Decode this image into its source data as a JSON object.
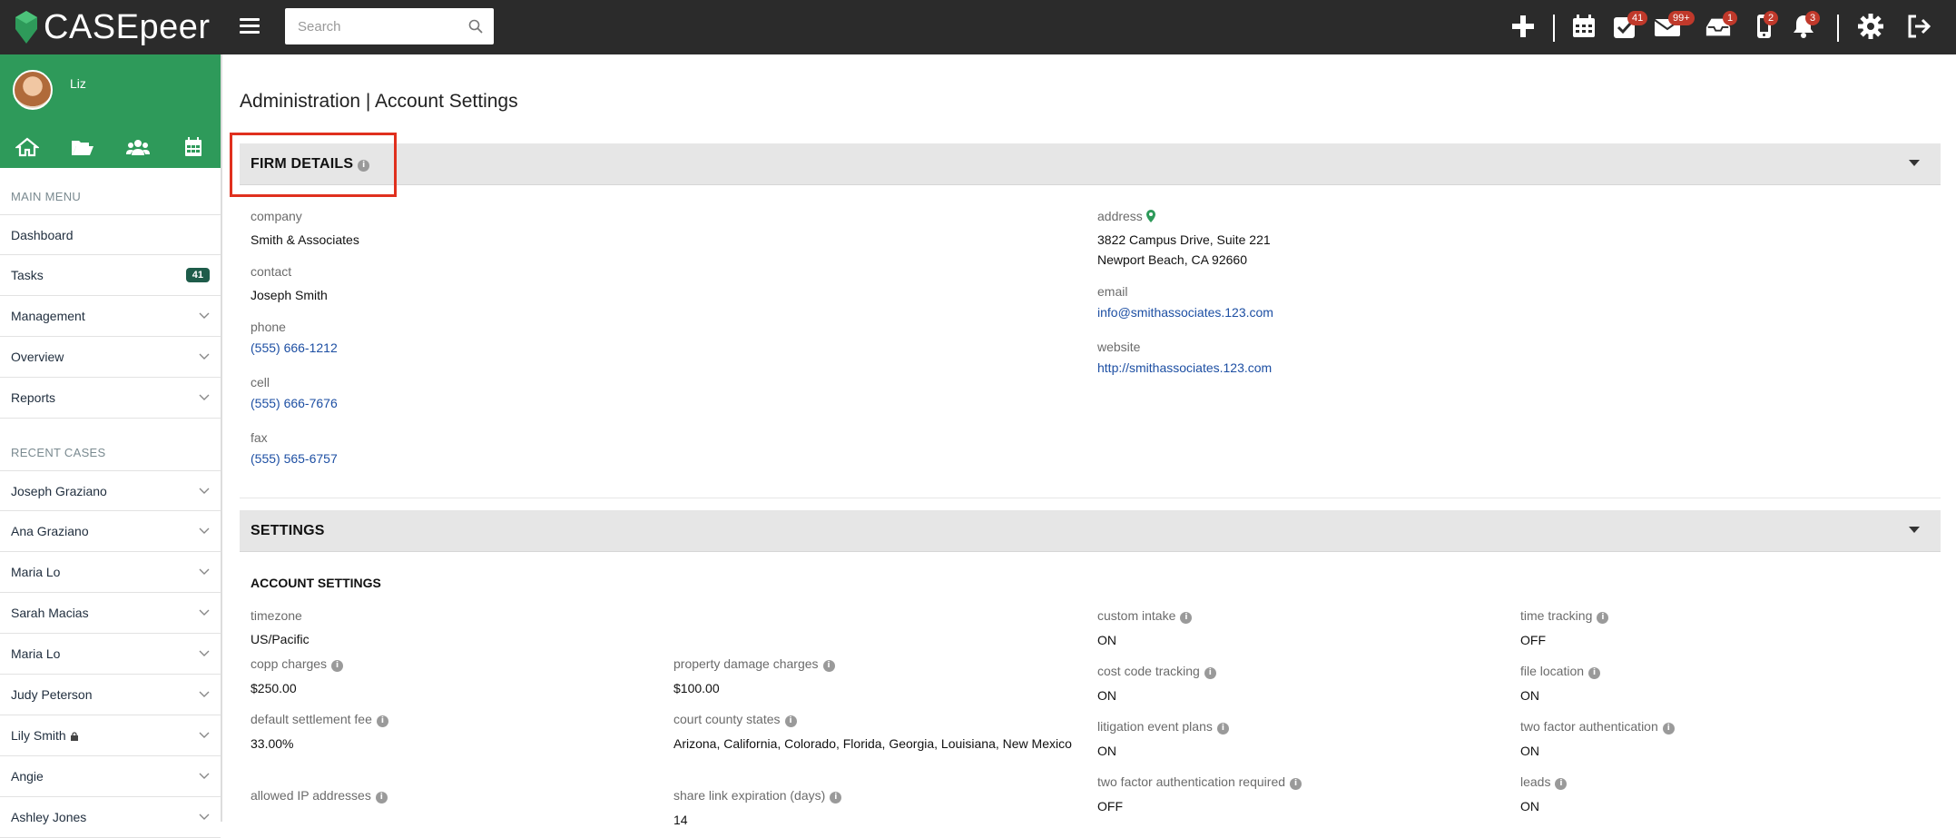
{
  "app": {
    "logo_text": "CASEpeer"
  },
  "topbar": {
    "search_placeholder": "Search",
    "badges": {
      "tasks": "41",
      "mail": "99+",
      "inbox": "1",
      "phone": "2",
      "notifications": "3"
    }
  },
  "sidebar": {
    "user_name": "Liz",
    "main_menu_title": "MAIN MENU",
    "main_menu": [
      {
        "label": "Dashboard"
      },
      {
        "label": "Tasks",
        "count": "41"
      },
      {
        "label": "Management"
      },
      {
        "label": "Overview"
      },
      {
        "label": "Reports"
      }
    ],
    "recent_cases_title": "RECENT CASES",
    "recent_cases": [
      {
        "label": "Joseph Graziano"
      },
      {
        "label": "Ana Graziano"
      },
      {
        "label": "Maria Lo"
      },
      {
        "label": "Sarah Macias"
      },
      {
        "label": "Maria Lo"
      },
      {
        "label": "Judy Peterson"
      },
      {
        "label": "Lily Smith"
      },
      {
        "label": "Angie"
      },
      {
        "label": "Ashley Jones"
      }
    ]
  },
  "page": {
    "title": "Administration | Account Settings"
  },
  "firm_details": {
    "title": "FIRM DETAILS",
    "company_label": "company",
    "company": "Smith & Associates",
    "contact_label": "contact",
    "contact": "Joseph Smith",
    "phone_label": "phone",
    "phone": "(555) 666-1212",
    "cell_label": "cell",
    "cell": "(555) 666-7676",
    "fax_label": "fax",
    "fax": "(555) 565-6757",
    "address_label": "address",
    "address_line1": "3822 Campus Drive, Suite 221",
    "address_line2": "Newport Beach, CA 92660",
    "email_label": "email",
    "email": "info@smithassociates.123.com",
    "website_label": "website",
    "website": "http://smithassociates.123.com"
  },
  "settings": {
    "title": "SETTINGS",
    "account_settings_title": "ACCOUNT SETTINGS",
    "timezone_label": "timezone",
    "timezone": "US/Pacific",
    "copp_charges_label": "copp charges",
    "copp_charges": "$250.00",
    "property_damage_label": "property damage charges",
    "property_damage": "$100.00",
    "default_settlement_fee_label": "default settlement fee",
    "default_settlement_fee": "33.00%",
    "court_county_states_label": "court county states",
    "court_county_states": "Arizona, California, Colorado, Florida, Georgia, Louisiana, New Mexico",
    "allowed_ip_label": "allowed IP addresses",
    "share_link_expiration_label": "share link expiration (days)",
    "share_link_expiration": "14",
    "custom_intake_label": "custom intake",
    "custom_intake": "ON",
    "cost_code_tracking_label": "cost code tracking",
    "cost_code_tracking": "ON",
    "litigation_event_plans_label": "litigation event plans",
    "litigation_event_plans": "ON",
    "two_factor_required_label": "two factor authentication required",
    "two_factor_required": "OFF",
    "time_tracking_label": "time tracking",
    "time_tracking": "OFF",
    "file_location_label": "file location",
    "file_location": "ON",
    "two_factor_label": "two factor authentication",
    "two_factor": "ON",
    "leads_label": "leads",
    "leads": "ON"
  },
  "icons": {
    "info": "i"
  },
  "colors": {
    "topbar": "#2b2b2b",
    "sidebar_accent": "#2e9a5a",
    "link": "#1d4fa3",
    "badge": "#c0392b",
    "highlight": "#e0301e"
  }
}
